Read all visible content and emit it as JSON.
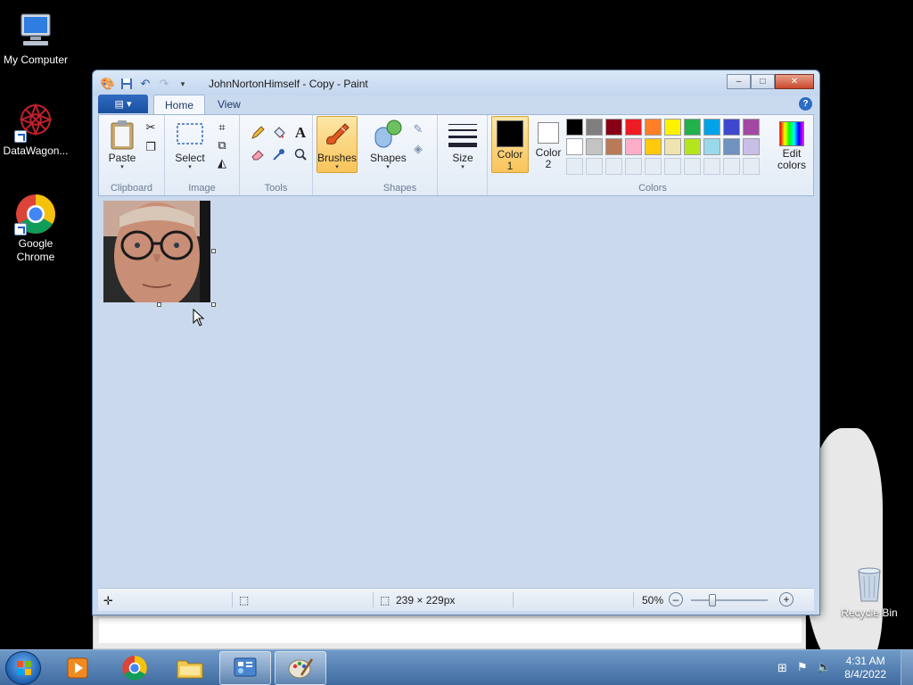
{
  "desktop": {
    "icons": [
      {
        "label": "My Computer"
      },
      {
        "label": "DataWagon..."
      },
      {
        "label": "Google Chrome"
      },
      {
        "label": "Recycle Bin"
      }
    ]
  },
  "window": {
    "title": "JohnNortonHimself - Copy - Paint",
    "controls": {
      "minimize": "–",
      "maximize": "□",
      "close": "✕"
    }
  },
  "ribbon": {
    "tabs": [
      {
        "label": "Home"
      },
      {
        "label": "View"
      }
    ],
    "groups": {
      "clipboard": {
        "label": "Clipboard",
        "paste": "Paste"
      },
      "image": {
        "label": "Image",
        "select": "Select"
      },
      "tools": {
        "label": "Tools"
      },
      "brushes": {
        "label": "Brushes"
      },
      "shapes": {
        "label": "Shapes",
        "shapes_btn": "Shapes"
      },
      "size": {
        "label": "Size"
      },
      "colors": {
        "label": "Colors",
        "color1_line1": "Color",
        "color1_line2": "1",
        "color2_line1": "Color",
        "color2_line2": "2",
        "edit_line1": "Edit",
        "edit_line2": "colors",
        "color1_value": "#000000",
        "color2_value": "#ffffff",
        "palette_row1": [
          "#000000",
          "#7f7f7f",
          "#880015",
          "#ed1c24",
          "#ff7f27",
          "#fff200",
          "#22b14c",
          "#00a2e8",
          "#3f48cc",
          "#a349a4"
        ],
        "palette_row2": [
          "#ffffff",
          "#c3c3c3",
          "#b97a57",
          "#ffaec9",
          "#ffc90e",
          "#efe4b0",
          "#b5e61d",
          "#99d9ea",
          "#7092be",
          "#c8bfe7"
        ]
      }
    }
  },
  "statusbar": {
    "dimensions": "239 × 229px",
    "zoom": "50%"
  },
  "taskbar": {
    "time": "4:31 AM",
    "date": "8/4/2022"
  }
}
